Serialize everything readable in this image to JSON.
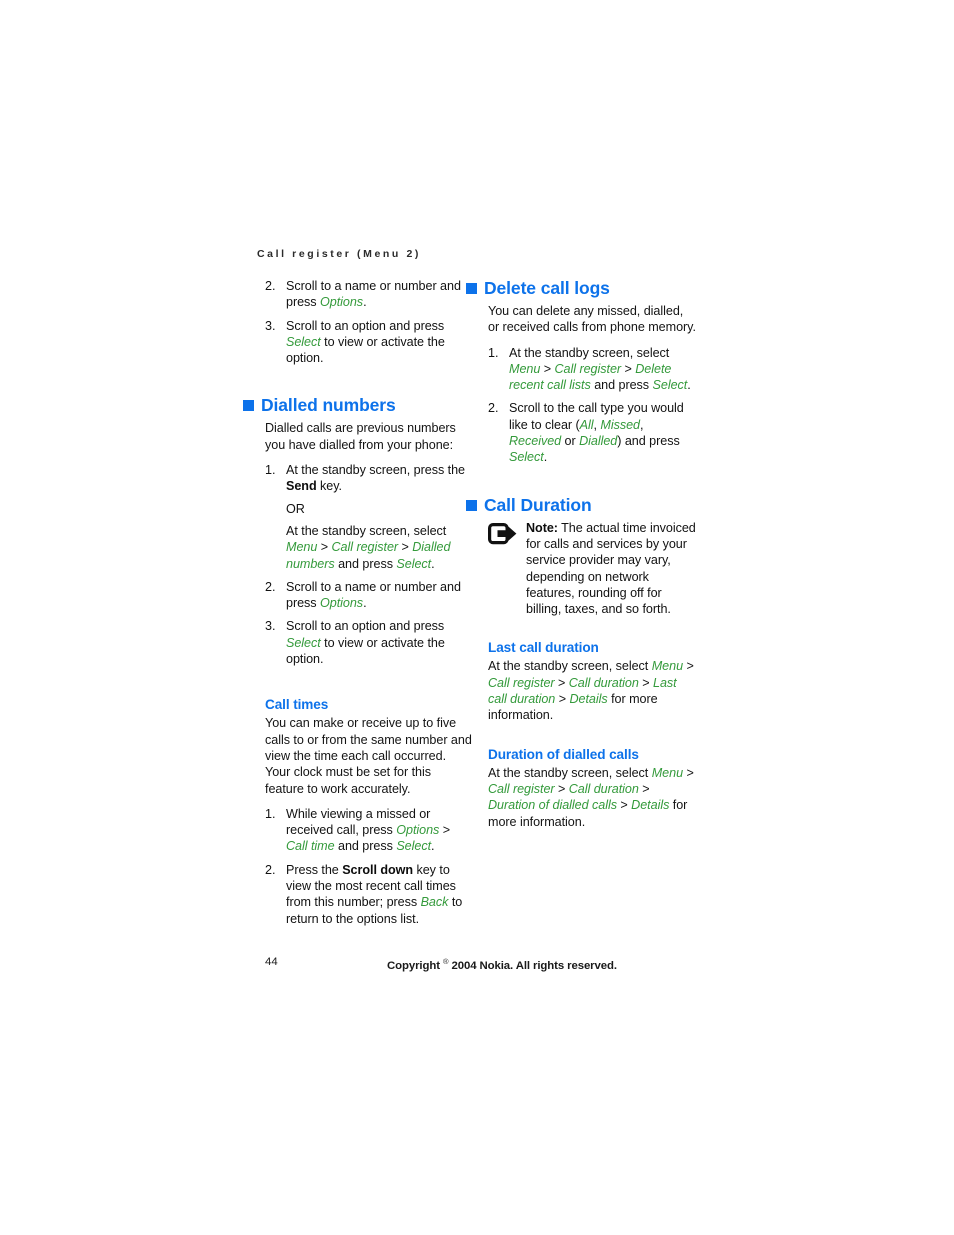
{
  "document": {
    "running_header": "Call register (Menu 2)",
    "page_number": "44",
    "copyright_prefix": "Copyright",
    "copyright_symbol": "®",
    "copyright_suffix": "2004 Nokia. All rights reserved."
  },
  "colors": {
    "heading_blue": "#0d72ea",
    "ui_label_green": "#349a3b",
    "body_text": "#141414",
    "page_background": "#ffffff"
  },
  "left_column": {
    "continued_steps": [
      {
        "number": "2.",
        "parts": [
          {
            "type": "text",
            "text": "Scroll to a name or number and press "
          },
          {
            "type": "ui",
            "text": "Options"
          },
          {
            "type": "text",
            "text": "."
          }
        ]
      },
      {
        "number": "3.",
        "parts": [
          {
            "type": "text",
            "text": "Scroll to an option and press "
          },
          {
            "type": "ui",
            "text": "Select"
          },
          {
            "type": "text",
            "text": " to view or activate the option."
          }
        ]
      }
    ],
    "dialled_numbers": {
      "heading": "Dialled numbers",
      "intro": "Dialled calls are previous numbers you have dialled from your phone:",
      "steps": [
        {
          "number": "1.",
          "parts": [
            {
              "type": "text",
              "text": "At the standby screen, press the "
            },
            {
              "type": "bold",
              "text": "Send"
            },
            {
              "type": "text",
              "text": " key."
            }
          ],
          "sub_or": "OR",
          "sub_parts": [
            {
              "type": "text",
              "text": "At the standby screen, select "
            },
            {
              "type": "ui",
              "text": "Menu"
            },
            {
              "type": "sep",
              "text": " > "
            },
            {
              "type": "ui",
              "text": "Call register"
            },
            {
              "type": "sep",
              "text": " > "
            },
            {
              "type": "ui",
              "text": "Dialled numbers"
            },
            {
              "type": "text",
              "text": " and press "
            },
            {
              "type": "ui",
              "text": "Select"
            },
            {
              "type": "text",
              "text": "."
            }
          ]
        },
        {
          "number": "2.",
          "parts": [
            {
              "type": "text",
              "text": "Scroll to a name or number and press "
            },
            {
              "type": "ui",
              "text": "Options"
            },
            {
              "type": "text",
              "text": "."
            }
          ]
        },
        {
          "number": "3.",
          "parts": [
            {
              "type": "text",
              "text": "Scroll to an option and press "
            },
            {
              "type": "ui",
              "text": "Select"
            },
            {
              "type": "text",
              "text": " to view or activate the option."
            }
          ]
        }
      ]
    },
    "call_times": {
      "heading": "Call times",
      "intro": "You can make or receive up to five calls to or from the same number and view the time each call occurred. Your clock must be set for this feature to work accurately.",
      "steps": [
        {
          "number": "1.",
          "parts": [
            {
              "type": "text",
              "text": "While viewing a missed or received call, press "
            },
            {
              "type": "ui",
              "text": "Options"
            },
            {
              "type": "sep",
              "text": " > "
            },
            {
              "type": "ui",
              "text": "Call time"
            },
            {
              "type": "text",
              "text": " and press "
            },
            {
              "type": "ui",
              "text": "Select"
            },
            {
              "type": "text",
              "text": "."
            }
          ]
        },
        {
          "number": "2.",
          "parts": [
            {
              "type": "text",
              "text": "Press the "
            },
            {
              "type": "bold",
              "text": "Scroll down"
            },
            {
              "type": "text",
              "text": " key to view the most recent call times from this number; press "
            },
            {
              "type": "ui",
              "text": "Back"
            },
            {
              "type": "text",
              "text": " to return to the options list."
            }
          ]
        }
      ]
    }
  },
  "right_column": {
    "delete_call_logs": {
      "heading": "Delete call logs",
      "intro": "You can delete any missed, dialled, or received calls from phone memory.",
      "steps": [
        {
          "number": "1.",
          "parts": [
            {
              "type": "text",
              "text": "At the standby screen, select "
            },
            {
              "type": "ui",
              "text": "Menu"
            },
            {
              "type": "sep",
              "text": " > "
            },
            {
              "type": "ui",
              "text": "Call register"
            },
            {
              "type": "sep",
              "text": " > "
            },
            {
              "type": "ui",
              "text": "Delete recent call lists"
            },
            {
              "type": "text",
              "text": " and press "
            },
            {
              "type": "ui",
              "text": "Select"
            },
            {
              "type": "text",
              "text": "."
            }
          ]
        },
        {
          "number": "2.",
          "parts": [
            {
              "type": "text",
              "text": "Scroll to the call type you would like to clear ("
            },
            {
              "type": "ui",
              "text": "All"
            },
            {
              "type": "text",
              "text": ", "
            },
            {
              "type": "ui",
              "text": "Missed"
            },
            {
              "type": "text",
              "text": ", "
            },
            {
              "type": "ui",
              "text": "Received"
            },
            {
              "type": "text",
              "text": " or "
            },
            {
              "type": "ui",
              "text": "Dialled"
            },
            {
              "type": "text",
              "text": ") and press "
            },
            {
              "type": "ui",
              "text": "Select"
            },
            {
              "type": "text",
              "text": "."
            }
          ]
        }
      ]
    },
    "call_duration": {
      "heading": "Call Duration",
      "note": {
        "icon": "note-arrow-icon",
        "label": "Note:",
        "text": " The actual time invoiced for calls and services by your service provider may vary, depending on network features, rounding off for billing, taxes, and so forth."
      },
      "last_call_duration": {
        "heading": "Last call duration",
        "parts": [
          {
            "type": "text",
            "text": "At the standby screen, select "
          },
          {
            "type": "ui",
            "text": "Menu"
          },
          {
            "type": "sep",
            "text": " > "
          },
          {
            "type": "ui",
            "text": "Call register"
          },
          {
            "type": "sep",
            "text": " > "
          },
          {
            "type": "ui",
            "text": "Call duration"
          },
          {
            "type": "sep",
            "text": " > "
          },
          {
            "type": "ui",
            "text": "Last call duration"
          },
          {
            "type": "sep",
            "text": " > "
          },
          {
            "type": "ui",
            "text": "Details"
          },
          {
            "type": "text",
            "text": " for more information."
          }
        ]
      },
      "duration_of_dialled_calls": {
        "heading": "Duration of dialled calls",
        "parts": [
          {
            "type": "text",
            "text": "At the standby screen, select "
          },
          {
            "type": "ui",
            "text": "Menu"
          },
          {
            "type": "sep",
            "text": " > "
          },
          {
            "type": "ui",
            "text": "Call register"
          },
          {
            "type": "sep",
            "text": " > "
          },
          {
            "type": "ui",
            "text": "Call duration"
          },
          {
            "type": "sep",
            "text": " > "
          },
          {
            "type": "ui",
            "text": "Duration of dialled calls"
          },
          {
            "type": "sep",
            "text": " > "
          },
          {
            "type": "ui",
            "text": "Details"
          },
          {
            "type": "text",
            "text": " for more information."
          }
        ]
      }
    }
  }
}
